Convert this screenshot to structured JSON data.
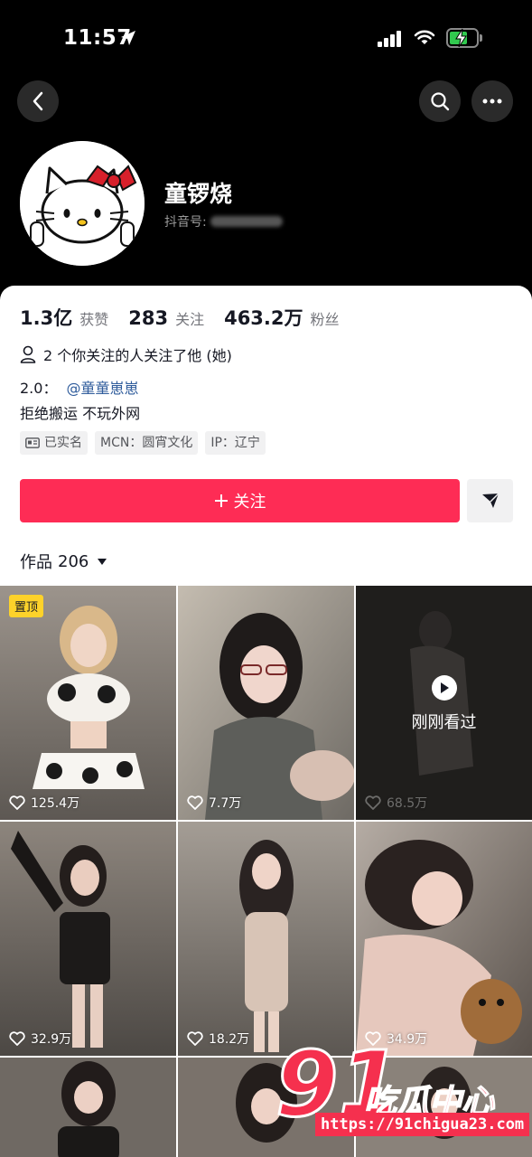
{
  "status_bar": {
    "time": "11:57"
  },
  "profile": {
    "name": "童锣烧",
    "douyin_id_label": "抖音号:"
  },
  "stats": [
    {
      "value": "1.3亿",
      "label": "获赞"
    },
    {
      "value": "283",
      "label": "关注"
    },
    {
      "value": "463.2万",
      "label": "粉丝"
    }
  ],
  "mutual_follow": "2 个你关注的人关注了他 (她)",
  "bio": {
    "prefix": "2.0：",
    "mention": "@童童崽崽",
    "line2": "拒绝搬运 不玩外网"
  },
  "tags": [
    {
      "label": "已实名",
      "icon": "id-card-icon"
    },
    {
      "label": "MCN：圆宵文化"
    },
    {
      "label": "IP：辽宁"
    }
  ],
  "follow_button": "关注",
  "works": {
    "label": "作品",
    "count": "206"
  },
  "videos": [
    {
      "likes": "125.4万",
      "pinned_label": "置顶"
    },
    {
      "likes": "7.7万"
    },
    {
      "likes": "68.5万",
      "watched_label": "刚刚看过"
    },
    {
      "likes": "32.9万"
    },
    {
      "likes": "18.2万"
    },
    {
      "likes": "34.9万"
    }
  ],
  "watermark": {
    "big": "91",
    "name": "吃瓜中心",
    "url": "https://91chigua23.com"
  },
  "colors": {
    "accent": "#fe2c55",
    "mention": "#2e5b9b",
    "pin": "#fdd22a"
  }
}
